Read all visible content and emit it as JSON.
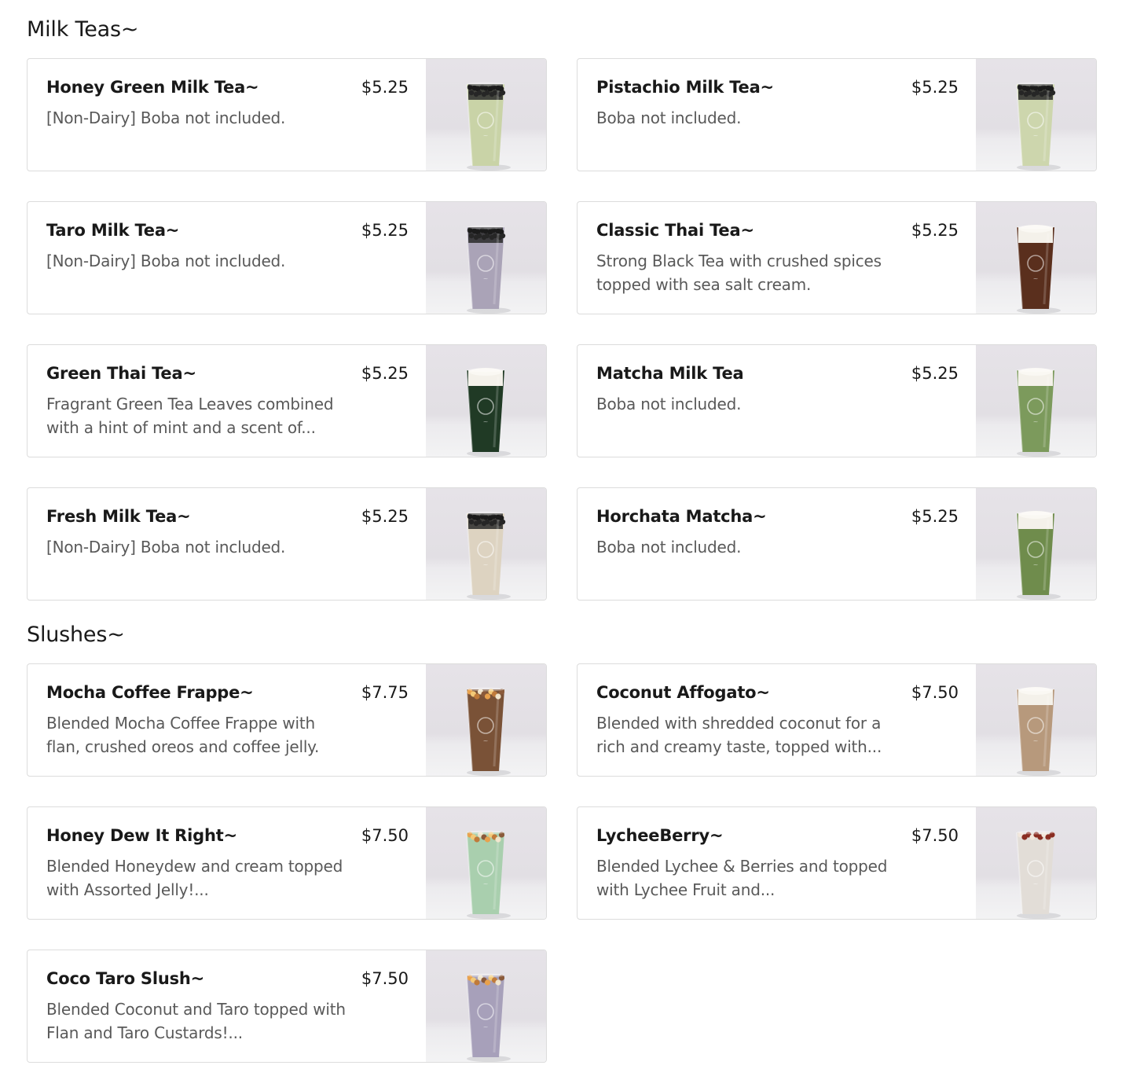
{
  "sections": [
    {
      "title": "Milk Teas~",
      "items": [
        {
          "name": "Honey Green Milk Tea~",
          "price": "$5.25",
          "description": "[Non-Dairy] Boba not included.",
          "drink_color": "#c9d3a7",
          "topping": "boba"
        },
        {
          "name": "Pistachio Milk Tea~",
          "price": "$5.25",
          "description": "Boba not included.",
          "drink_color": "#cdd6ad",
          "topping": "boba"
        },
        {
          "name": "Taro Milk Tea~",
          "price": "$5.25",
          "description": "[Non-Dairy] Boba not included.",
          "drink_color": "#aaa3b7",
          "topping": "boba"
        },
        {
          "name": "Classic Thai Tea~",
          "price": "$5.25",
          "description": "Strong Black Tea with crushed spices topped with sea salt cream.",
          "drink_color": "#5a2f1d",
          "topping": "cream"
        },
        {
          "name": "Green Thai Tea~",
          "price": "$5.25",
          "description": "Fragrant Green Tea Leaves combined with a hint of mint and a scent of...",
          "drink_color": "#203a25",
          "topping": "cream"
        },
        {
          "name": "Matcha Milk Tea",
          "price": "$5.25",
          "description": "Boba not included.",
          "drink_color": "#7c9a5c",
          "topping": "cream"
        },
        {
          "name": "Fresh Milk Tea~",
          "price": "$5.25",
          "description": "[Non-Dairy] Boba not included.",
          "drink_color": "#ddd3c1",
          "topping": "boba"
        },
        {
          "name": "Horchata Matcha~",
          "price": "$5.25",
          "description": "Boba not included.",
          "drink_color": "#6f8c4c",
          "topping": "cream"
        }
      ]
    },
    {
      "title": "Slushes~",
      "items": [
        {
          "name": "Mocha Coffee Frappe~",
          "price": "$7.75",
          "description": "Blended Mocha Coffee Frappe with flan, crushed oreos and coffee jelly.",
          "drink_color": "#7a5237",
          "topping": "jelly"
        },
        {
          "name": "Coconut Affogato~",
          "price": "$7.50",
          "description": "Blended with shredded coconut for a rich and creamy taste, topped with...",
          "drink_color": "#b7997c",
          "topping": "cream"
        },
        {
          "name": "Honey Dew It Right~",
          "price": "$7.50",
          "description": "Blended Honeydew and cream topped with Assorted Jelly!...",
          "drink_color": "#a9cfae",
          "topping": "jelly"
        },
        {
          "name": "LycheeBerry~",
          "price": "$7.50",
          "description": "Blended Lychee & Berries and topped with Lychee Fruit and...",
          "drink_color": "#e2ddd7",
          "topping": "berries"
        },
        {
          "name": "Coco Taro Slush~",
          "price": "$7.50",
          "description": "Blended Coconut and Taro topped with Flan and Taro Custards!...",
          "drink_color": "#a7a0ba",
          "topping": "jelly"
        }
      ]
    }
  ]
}
